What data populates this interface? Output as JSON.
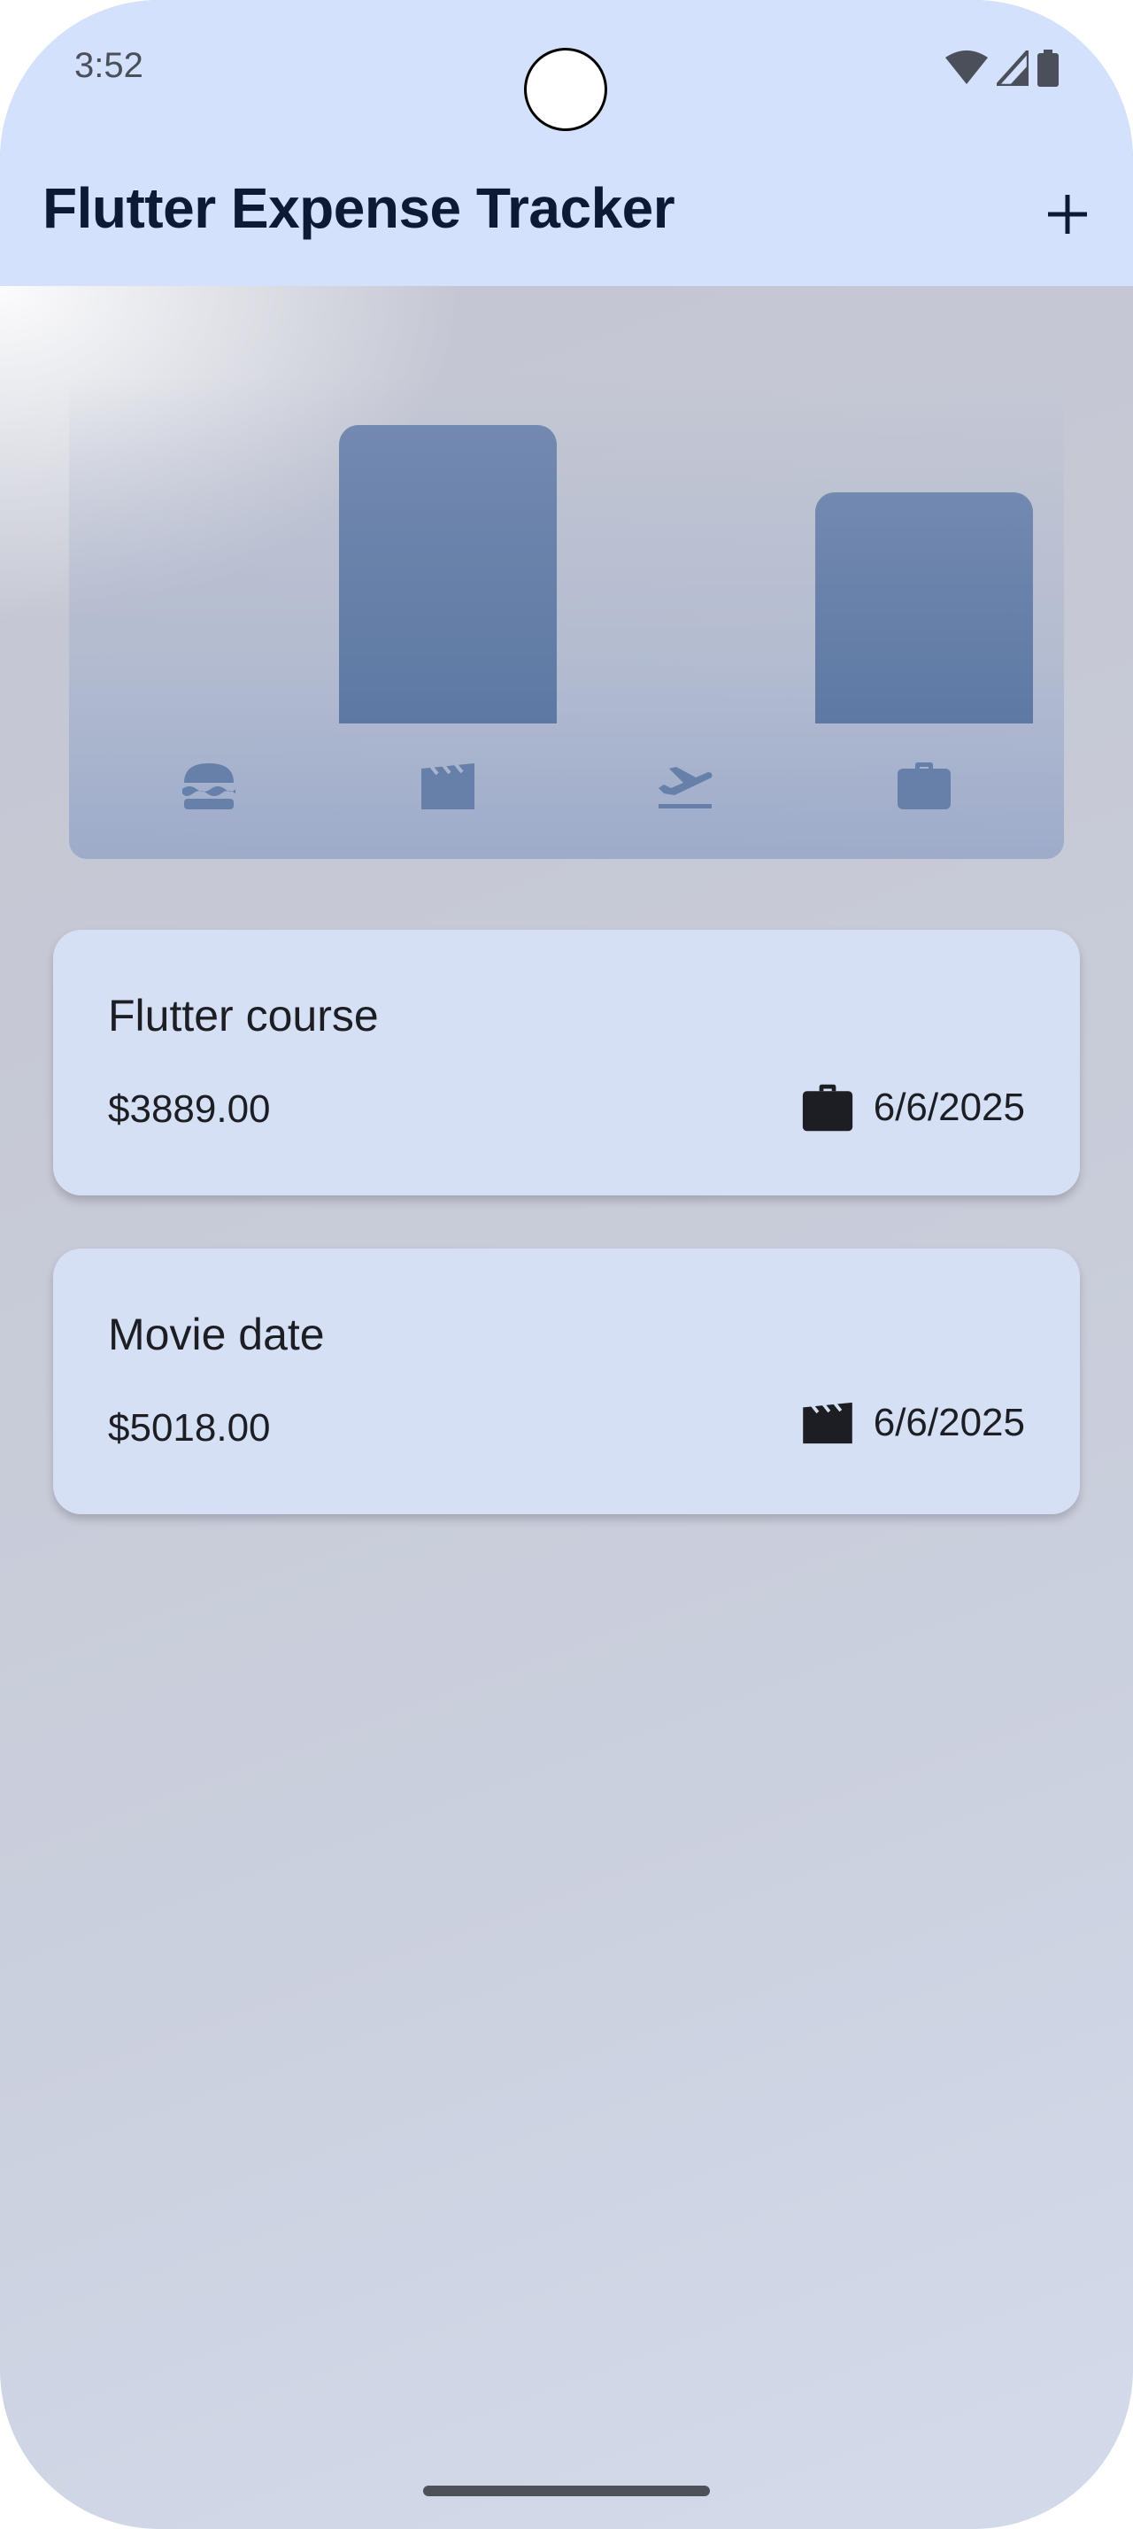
{
  "status_bar": {
    "time": "3:52",
    "icons": [
      "wifi-icon",
      "signal-icon",
      "battery-icon"
    ]
  },
  "app_bar": {
    "title": "Flutter Expense Tracker",
    "action_icon": "add-icon"
  },
  "chart": {
    "categories": [
      "food",
      "leisure",
      "travel",
      "work"
    ],
    "bucket_fill": [
      0,
      1.0,
      0,
      0.775
    ],
    "icons": [
      "burger-icon",
      "clapperboard-icon",
      "flight-takeoff-icon",
      "briefcase-icon"
    ]
  },
  "expenses": [
    {
      "title": "Flutter course",
      "amount": "$3889.00",
      "category_icon": "briefcase-icon",
      "date": "6/6/2025"
    },
    {
      "title": "Movie date",
      "amount": "$5018.00",
      "category_icon": "clapperboard-icon",
      "date": "6/6/2025"
    }
  ],
  "colors": {
    "app_bar": "#d3e1fd",
    "bar": "#6680a9",
    "card": "#d6e0f5",
    "title_text": "#0c1a36"
  }
}
